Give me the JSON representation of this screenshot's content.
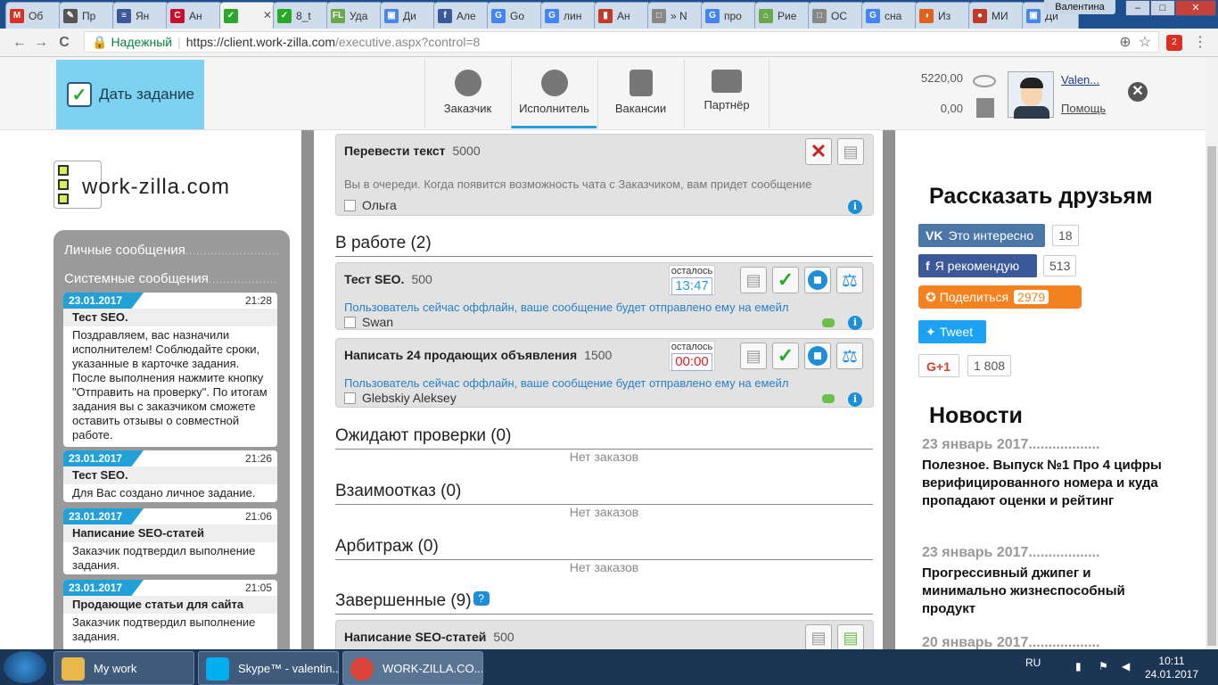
{
  "browser": {
    "tabs": [
      {
        "label": "Об",
        "fav": "M",
        "color": "#d93025"
      },
      {
        "label": "Пр",
        "fav": "✎",
        "color": "#555"
      },
      {
        "label": "Ян",
        "fav": "≡",
        "color": "#3b5998"
      },
      {
        "label": "Ан",
        "fav": "C",
        "color": "#c8102e"
      },
      {
        "label": "",
        "fav": "✓",
        "color": "#2aa82a"
      },
      {
        "label": "8_t",
        "fav": "✓",
        "color": "#2aa82a"
      },
      {
        "label": "Уда",
        "fav": "FL",
        "color": "#6aa84f"
      },
      {
        "label": "Ди",
        "fav": "▣",
        "color": "#4a86e8"
      },
      {
        "label": "Але",
        "fav": "f",
        "color": "#3b5998"
      },
      {
        "label": "Go",
        "fav": "G",
        "color": "#4285f4"
      },
      {
        "label": "лин",
        "fav": "G",
        "color": "#4285f4"
      },
      {
        "label": "Ан",
        "fav": "▮",
        "color": "#c0392b"
      },
      {
        "label": "» N",
        "fav": "□",
        "color": "#888"
      },
      {
        "label": "про",
        "fav": "G",
        "color": "#4285f4"
      },
      {
        "label": "Рие",
        "fav": "⌂",
        "color": "#6aa84f"
      },
      {
        "label": "ОС",
        "fav": "□",
        "color": "#888"
      },
      {
        "label": "сна",
        "fav": "G",
        "color": "#4285f4"
      },
      {
        "label": "Из",
        "fav": "◑",
        "color": "#e06020"
      },
      {
        "label": "МИ",
        "fav": "●",
        "color": "#c0392b"
      },
      {
        "label": "Ди",
        "fav": "▣",
        "color": "#4a86e8"
      }
    ],
    "window_user": "Валентина",
    "win_min": "–",
    "win_max": "□",
    "win_close": "✕",
    "back": "←",
    "forward": "→",
    "reload": "C",
    "lock": "🔒",
    "secure": "Надежный",
    "url_host": "https://client.work-zilla.com",
    "url_path": "/executive.aspx?control=8",
    "zoom": "⊕",
    "star": "☆",
    "menu": "⋮",
    "ext": "2"
  },
  "header": {
    "give_task": "Дать задание",
    "give_task_check": "✓",
    "nav": [
      {
        "label": "Заказчик",
        "icon": "customer-icon"
      },
      {
        "label": "Исполнитель",
        "icon": "executor-icon",
        "active": true
      },
      {
        "label": "Вакансии",
        "icon": "vacancies-icon"
      },
      {
        "label": "Партнёр",
        "icon": "partner-icon"
      }
    ],
    "balance1": "5220,00",
    "balance2": "0,00",
    "username": "Valen...",
    "help": "Помощь",
    "close": "✕"
  },
  "left": {
    "logo_text": "work-zilla.com",
    "link_personal": "Личные сообщения",
    "link_system": "Системные сообщения",
    "dots": "..........................",
    "messages": [
      {
        "date": "23.01.2017",
        "time": "21:28",
        "title": "Тест SEO.",
        "body": "Поздравляем, вас назначили исполнителем! Соблюдайте сроки, указанные в карточке задания. После выполнения нажмите кнопку \"Отправить на проверку\". По итогам задания вы с заказчиком сможете оставить отзывы о совместной работе."
      },
      {
        "date": "23.01.2017",
        "time": "21:26",
        "title": "Тест SEO.",
        "body": "Для Вас создано личное задание."
      },
      {
        "date": "23.01.2017",
        "time": "21:06",
        "title": "Написание SEO-статей",
        "body": "Заказчик подтвердил выполнение задания."
      },
      {
        "date": "23.01.2017",
        "time": "21:05",
        "title": "Продающие статьи для сайта",
        "body": "Заказчик подтвердил выполнение задания."
      }
    ]
  },
  "center": {
    "queued_task": {
      "title": "Перевести текст",
      "price": "5000",
      "note": "Вы в очереди. Когда появится возможность чата с Заказчиком, вам придет сообщение",
      "user": "Ольга"
    },
    "in_work_heading": "В работе (2)",
    "work_tasks": [
      {
        "title": "Тест SEO.",
        "price": "500",
        "timer_label": "осталось",
        "timer": "13:47",
        "timer_color": "#22a0d8",
        "note": "Пользователь сейчас оффлайн, ваше сообщение будет отправлено ему на емейл",
        "user": "Swan"
      },
      {
        "title": "Написать 24 продающих объявления",
        "price": "1500",
        "timer_label": "осталось",
        "timer": "00:00",
        "timer_color": "#d82222",
        "note": "Пользователь сейчас оффлайн, ваше сообщение будет отправлено ему на емейл",
        "user": "Glebskiy Aleksey"
      }
    ],
    "review_heading": "Ожидают проверки (0)",
    "mutual_heading": "Взаимоотказ (0)",
    "arbitrage_heading": "Арбитраж (0)",
    "empty": "Нет заказов",
    "completed_heading": "Завершенные (9)",
    "completed_help": "?",
    "completed_task": {
      "title": "Написание SEO-статей",
      "price": "500"
    },
    "btn_cancel": "✕",
    "btn_doc": "▤",
    "btn_ok": "✓",
    "btn_scale": "⚖",
    "info": "i"
  },
  "right": {
    "share_title": "Рассказать друзьям",
    "vk_label": "Это интересно",
    "vk_count": "18",
    "vk_color": "#4a76a8",
    "fb_label": "Я рекомендую",
    "fb_count": "513",
    "fb_color": "#3b5998",
    "ok_label": "Поделиться",
    "ok_count": "2979",
    "ok_color": "#f58220",
    "tw_label": "Tweet",
    "tw_color": "#1da1f2",
    "gp_label": "G+1",
    "gp_count": "1 808",
    "news_title": "Новости",
    "news": [
      {
        "date": "23 январь 2017..................",
        "text": "Полезное. Выпуск №1 Про 4 цифры верифицированного номера и куда пропадают оценки и рейтинг"
      },
      {
        "date": "23 январь 2017..................",
        "text": "Прогрессивный джипег и минимально жизнеспособный продукт"
      },
      {
        "date": "20 январь 2017..................",
        "text": ""
      }
    ]
  },
  "taskbar": {
    "items": [
      {
        "label": "My work",
        "color": "#e8b84a"
      },
      {
        "label": "Skype™ - valentin...",
        "color": "#00aff0"
      },
      {
        "label": "WORK-ZILLA.CO...",
        "color": "#db4437"
      }
    ],
    "lang": "RU",
    "time": "10:11",
    "date": "24.01.2017"
  }
}
